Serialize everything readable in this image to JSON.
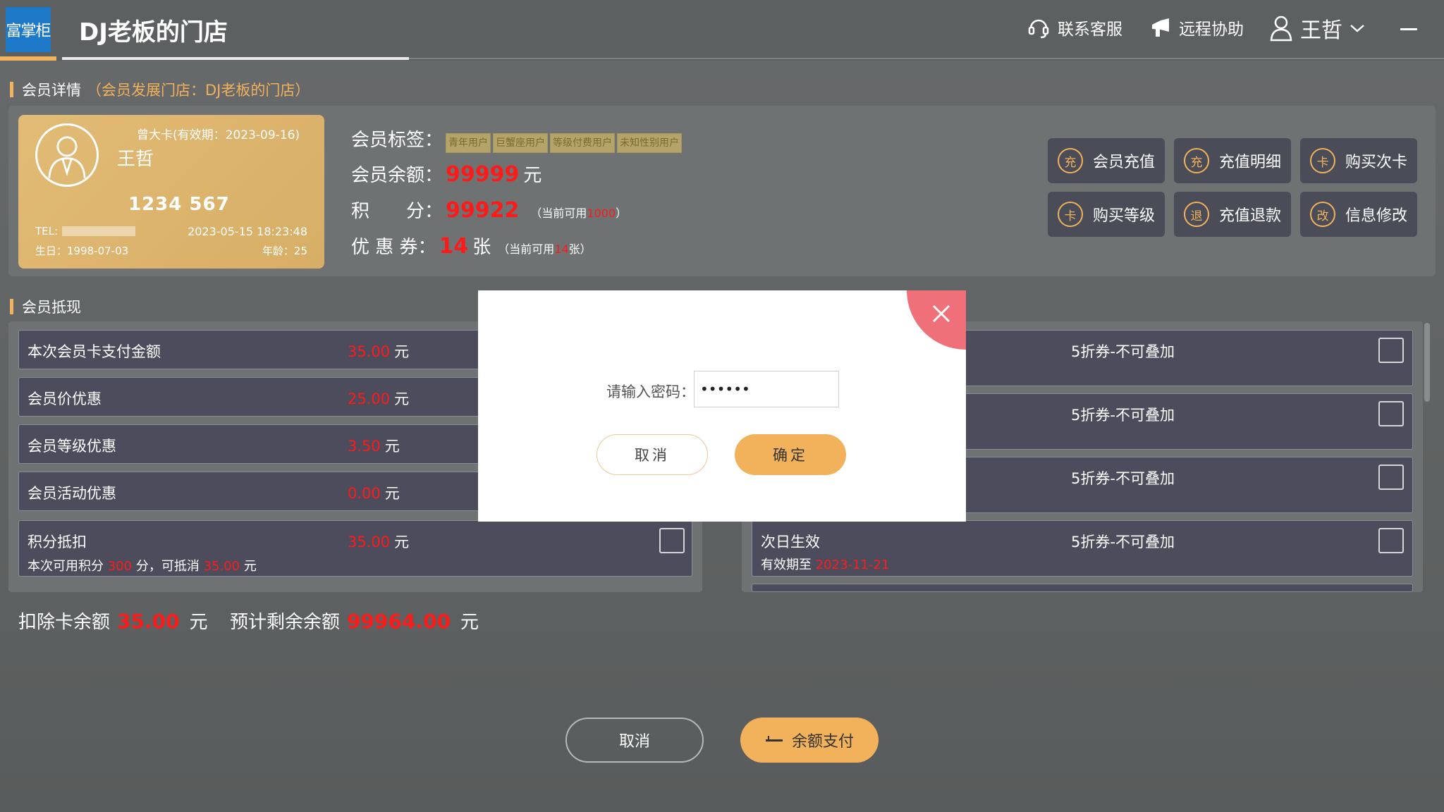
{
  "header": {
    "logo_text": "富掌柜",
    "store_title": "DJ老板的门店",
    "support_label": "联系客服",
    "remote_label": "远程协助",
    "user_name": "王哲"
  },
  "member_section": {
    "title": "会员详情",
    "subtitle": "（会员发展门店：DJ老板的门店）"
  },
  "card": {
    "validity": "曾大卡(有效期：2023-09-16)",
    "name": "王哲",
    "number": "1234 567",
    "tel_label": "TEL:",
    "datetime": "2023-05-15 18:23:48",
    "birthday": "生日：1998-07-03",
    "age": "年龄：25"
  },
  "member_info": {
    "tags_label": "会员标签：",
    "tags": [
      "青年用户",
      "巨蟹座用户",
      "等级付费用户",
      "未知性别用户"
    ],
    "balance_label": "会员余额：",
    "balance": "99999",
    "balance_unit": "元",
    "points_label": "积　　分：",
    "points": "99922",
    "points_note_prefix": "（当前可用",
    "points_available": "1000",
    "points_note_suffix": "）",
    "coupon_label": "优 惠 券：",
    "coupon_count": "14",
    "coupon_unit": "张",
    "coupon_note_prefix": "（当前可用",
    "coupon_available": "14",
    "coupon_note_suffix": "张）"
  },
  "actions": [
    {
      "icon": "充",
      "label": "会员充值"
    },
    {
      "icon": "充",
      "label": "充值明细"
    },
    {
      "icon": "卡",
      "label": "购买次卡"
    },
    {
      "icon": "卡",
      "label": "购买等级"
    },
    {
      "icon": "退",
      "label": "充值退款"
    },
    {
      "icon": "改",
      "label": "信息修改"
    }
  ],
  "deduction_section": {
    "title": "会员抵现"
  },
  "deductions": [
    {
      "label": "本次会员卡支付金额",
      "value": "35.00",
      "unit": "元"
    },
    {
      "label": "会员价优惠",
      "value": "25.00",
      "unit": "元"
    },
    {
      "label": "会员等级优惠",
      "value": "3.50",
      "unit": "元"
    },
    {
      "label": "会员活动优惠",
      "value": "0.00",
      "unit": "元"
    }
  ],
  "points_deduction": {
    "label": "积分抵扣",
    "value": "35.00",
    "unit": "元",
    "sub_prefix": "本次可用积分",
    "sub_points": "300",
    "sub_mid": "分，可抵消",
    "sub_amount": "35.00",
    "sub_suffix": "元"
  },
  "coupons": [
    {
      "title": "5折券-不可叠加"
    },
    {
      "title": "5折券-不可叠加"
    },
    {
      "title": "5折券-不可叠加"
    },
    {
      "title": "5折券-不可叠加",
      "left_text": "次日生效",
      "exp_label": "有效期至",
      "exp_date": "2023-11-21"
    }
  ],
  "totals": {
    "deduct_label": "扣除卡余额",
    "deduct_value": "35.00",
    "deduct_unit": "元",
    "remain_label": "预计剩余余额",
    "remain_value": "99964.00",
    "remain_unit": "元"
  },
  "bottom": {
    "cancel_label": "取消",
    "pay_label": "余额支付"
  },
  "modal": {
    "password_label": "请输入密码：",
    "password_value": "••••••",
    "cancel_label": "取消",
    "ok_label": "确定"
  },
  "colors": {
    "accent": "#f2b15b",
    "highlight_red": "#ff1a1a",
    "close_button": "#f0707a"
  }
}
